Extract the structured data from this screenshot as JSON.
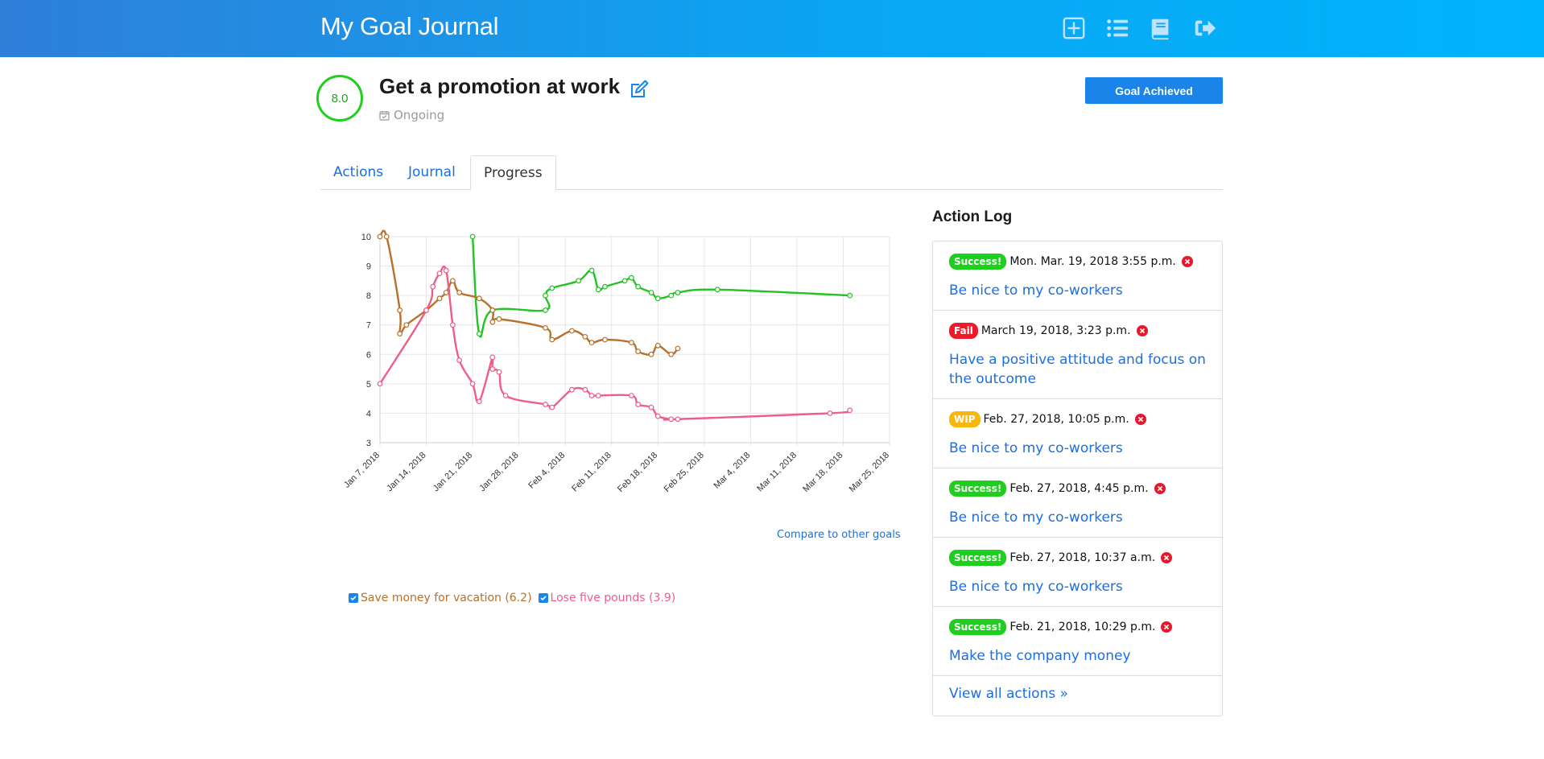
{
  "header": {
    "brand": "My Goal Journal",
    "icons": [
      "plus-square-icon",
      "list-icon",
      "book-icon",
      "sign-out-icon"
    ]
  },
  "goal": {
    "score": "8.0",
    "title": "Get a promotion at work",
    "status": "Ongoing",
    "achieved_button": "Goal Achieved"
  },
  "tabs": [
    {
      "label": "Actions",
      "active": false
    },
    {
      "label": "Journal",
      "active": false
    },
    {
      "label": "Progress",
      "active": true
    }
  ],
  "chart_data": {
    "type": "line",
    "title": "",
    "xlabel": "",
    "ylabel": "",
    "ylim": [
      3,
      10
    ],
    "xlim": [
      "2018-01-07",
      "2018-03-25"
    ],
    "yticks": [
      3,
      4,
      5,
      6,
      7,
      8,
      9,
      10
    ],
    "xticks": [
      "Jan 7, 2018",
      "Jan 14, 2018",
      "Jan 21, 2018",
      "Jan 28, 2018",
      "Feb 4, 2018",
      "Feb 11, 2018",
      "Feb 18, 2018",
      "Feb 25, 2018",
      "Mar 4, 2018",
      "Mar 11, 2018",
      "Mar 18, 2018",
      "Mar 25, 2018"
    ],
    "grid": true,
    "series": [
      {
        "color": "#22c322",
        "points": [
          [
            "2018-01-21",
            10.0
          ],
          [
            "2018-01-22",
            6.7
          ],
          [
            "2018-01-24",
            7.5
          ],
          [
            "2018-02-01",
            7.5
          ],
          [
            "2018-02-01",
            8.0
          ],
          [
            "2018-02-02",
            8.25
          ],
          [
            "2018-02-06",
            8.5
          ],
          [
            "2018-02-08",
            8.85
          ],
          [
            "2018-02-09",
            8.2
          ],
          [
            "2018-02-10",
            8.3
          ],
          [
            "2018-02-13",
            8.5
          ],
          [
            "2018-02-14",
            8.6
          ],
          [
            "2018-02-15",
            8.3
          ],
          [
            "2018-02-17",
            8.1
          ],
          [
            "2018-02-18",
            7.9
          ],
          [
            "2018-02-20",
            8.0
          ],
          [
            "2018-02-21",
            8.1
          ],
          [
            "2018-02-27",
            8.2
          ],
          [
            "2018-03-19",
            8.0
          ]
        ]
      },
      {
        "name": "Save money for vacation (6.2)",
        "color": "#b8702a",
        "points": [
          [
            "2018-01-07",
            10.0
          ],
          [
            "2018-01-08",
            10.0
          ],
          [
            "2018-01-10",
            7.5
          ],
          [
            "2018-01-10",
            6.7
          ],
          [
            "2018-01-11",
            7.0
          ],
          [
            "2018-01-14",
            7.5
          ],
          [
            "2018-01-16",
            7.9
          ],
          [
            "2018-01-17",
            8.1
          ],
          [
            "2018-01-18",
            8.5
          ],
          [
            "2018-01-19",
            8.1
          ],
          [
            "2018-01-22",
            7.9
          ],
          [
            "2018-01-24",
            7.5
          ],
          [
            "2018-01-24",
            7.1
          ],
          [
            "2018-01-25",
            7.2
          ],
          [
            "2018-02-01",
            6.9
          ],
          [
            "2018-02-02",
            6.5
          ],
          [
            "2018-02-05",
            6.8
          ],
          [
            "2018-02-07",
            6.6
          ],
          [
            "2018-02-08",
            6.4
          ],
          [
            "2018-02-10",
            6.5
          ],
          [
            "2018-02-14",
            6.4
          ],
          [
            "2018-02-15",
            6.1
          ],
          [
            "2018-02-17",
            6.0
          ],
          [
            "2018-02-18",
            6.3
          ],
          [
            "2018-02-20",
            6.0
          ],
          [
            "2018-02-21",
            6.2
          ]
        ]
      },
      {
        "name": "Lose five pounds (3.9)",
        "color": "#ee5e88",
        "points": [
          [
            "2018-01-07",
            5.0
          ],
          [
            "2018-01-14",
            7.5
          ],
          [
            "2018-01-15",
            8.3
          ],
          [
            "2018-01-16",
            8.75
          ],
          [
            "2018-01-17",
            8.85
          ],
          [
            "2018-01-18",
            7.0
          ],
          [
            "2018-01-19",
            5.8
          ],
          [
            "2018-01-21",
            5.0
          ],
          [
            "2018-01-22",
            4.4
          ],
          [
            "2018-01-24",
            5.9
          ],
          [
            "2018-01-24",
            5.5
          ],
          [
            "2018-01-25",
            5.4
          ],
          [
            "2018-01-26",
            4.6
          ],
          [
            "2018-02-01",
            4.3
          ],
          [
            "2018-02-02",
            4.2
          ],
          [
            "2018-02-05",
            4.8
          ],
          [
            "2018-02-07",
            4.8
          ],
          [
            "2018-02-08",
            4.6
          ],
          [
            "2018-02-09",
            4.6
          ],
          [
            "2018-02-14",
            4.6
          ],
          [
            "2018-02-15",
            4.3
          ],
          [
            "2018-02-17",
            4.2
          ],
          [
            "2018-02-18",
            3.9
          ],
          [
            "2018-02-20",
            3.8
          ],
          [
            "2018-02-21",
            3.8
          ],
          [
            "2018-03-16",
            4.0
          ],
          [
            "2018-03-19",
            4.1
          ]
        ]
      }
    ]
  },
  "compare_link": "Compare to other goals",
  "legend": [
    {
      "label": "Save money for vacation (6.2)",
      "color": "#b8702a",
      "checked": true
    },
    {
      "label": "Lose five pounds (3.9)",
      "color": "#ee5e88",
      "checked": true
    }
  ],
  "action_log": {
    "title": "Action Log",
    "items": [
      {
        "badge": "Success!",
        "status": "success",
        "time": "Mon. Mar. 19, 2018 3:55 p.m.",
        "action": "Be nice to my co-workers"
      },
      {
        "badge": "Fail",
        "status": "fail",
        "time": "March 19, 2018, 3:23 p.m.",
        "action": "Have a positive attitude and focus on the outcome"
      },
      {
        "badge": "WIP",
        "status": "wip",
        "time": "Feb. 27, 2018, 10:05 p.m.",
        "action": "Be nice to my co-workers"
      },
      {
        "badge": "Success!",
        "status": "success",
        "time": "Feb. 27, 2018, 4:45 p.m.",
        "action": "Be nice to my co-workers"
      },
      {
        "badge": "Success!",
        "status": "success",
        "time": "Feb. 27, 2018, 10:37 a.m.",
        "action": "Be nice to my co-workers"
      },
      {
        "badge": "Success!",
        "status": "success",
        "time": "Feb. 21, 2018, 10:29 p.m.",
        "action": "Make the company money"
      }
    ],
    "view_all": "View all actions »"
  }
}
